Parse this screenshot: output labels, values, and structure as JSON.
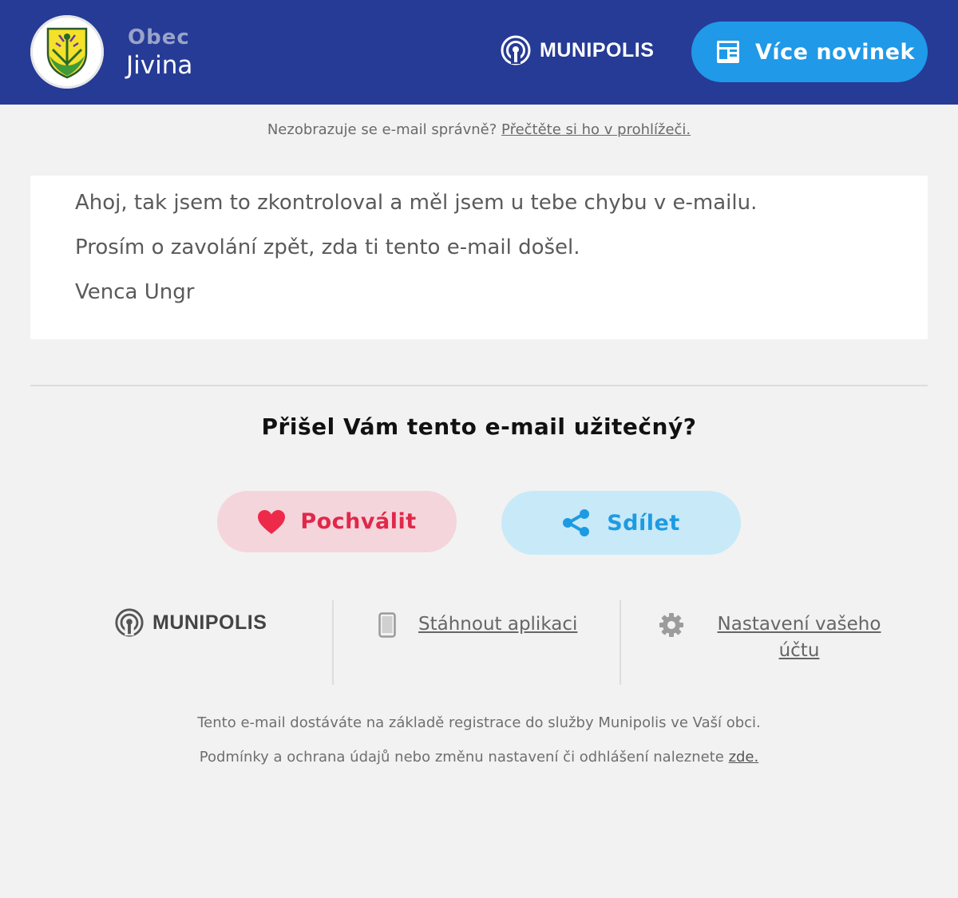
{
  "header": {
    "obec_label": "Obec",
    "town_name": "Jivina",
    "brand": "MUNIPOLIS",
    "more_news_label": "Více novinek"
  },
  "browser_note": {
    "text": "Nezobrazuje se e-mail správně?",
    "link": "Přečtěte si ho v prohlížeči."
  },
  "message": {
    "lines": [
      "Ahoj, tak jsem to zkontroloval a měl jsem u tebe chybu v e-mailu.",
      "Prosím o zavolání zpět, zda ti tento e-mail došel.",
      "Venca Ungr"
    ]
  },
  "feedback": {
    "question": "Přišel Vám tento e-mail užitečný?",
    "praise_label": "Pochválit",
    "share_label": "Sdílet"
  },
  "footer": {
    "brand": "MUNIPOLIS",
    "download_label": "Stáhnout aplikaci",
    "settings_label": "Nastavení vašeho účtu",
    "registration_note": "Tento e-mail dostáváte na základě registrace do služby Munipolis ve Vaší obci.",
    "terms_note": "Podmínky a ochrana údajů nebo změnu nastavení či odhlášení naleznete",
    "terms_link": "zde."
  },
  "colors": {
    "header_bg": "#263b96",
    "accent_blue": "#1f99e8",
    "praise_red": "#e0284a",
    "praise_bg": "#f5d5dc",
    "share_bg": "#c8e9f8"
  },
  "icons": {
    "crest": "municipal-crest-icon",
    "brand": "broadcast-icon",
    "news": "newspaper-icon",
    "praise": "heart-icon",
    "share": "share-icon",
    "download": "phone-icon",
    "settings": "gear-icon"
  }
}
